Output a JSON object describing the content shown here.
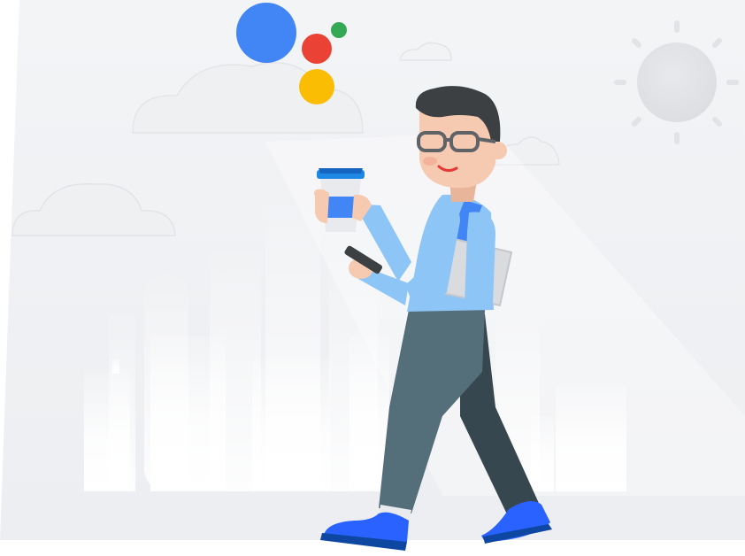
{
  "illustration": {
    "subject": "person-walking-with-coffee-and-phone",
    "icons": [
      "assistant-dots-icon",
      "sun-icon",
      "cloud-icon",
      "city-skyline"
    ],
    "colors": {
      "background": "#f1f2f4",
      "blue": "#4285f4",
      "red": "#ea4335",
      "yellow": "#fbbc04",
      "green": "#34a853",
      "shirt": "#8ec5f7",
      "pants": "#546e7a",
      "pants_shadow": "#37474f",
      "shoes": "#2962ff",
      "skin": "#f6c9b1",
      "hair": "#3c4043"
    }
  }
}
